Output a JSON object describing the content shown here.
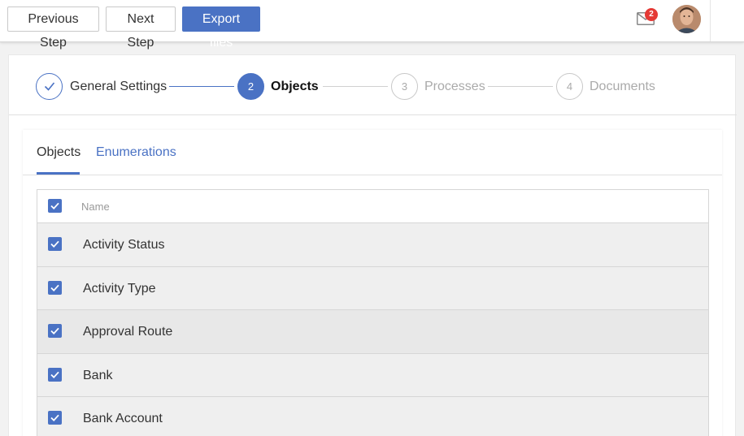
{
  "toolbar": {
    "previous_label": "Previous Step",
    "next_label": "Next Step",
    "export_label": "Export files"
  },
  "notifications": {
    "count": "2",
    "icon": "mail-icon"
  },
  "user": {
    "avatar_icon": "avatar"
  },
  "colors": {
    "accent": "#4a72c4",
    "badge": "#e53935"
  },
  "stepper": {
    "steps": [
      {
        "number": "",
        "label": "General Settings",
        "state": "done"
      },
      {
        "number": "2",
        "label": "Objects",
        "state": "active"
      },
      {
        "number": "3",
        "label": "Processes",
        "state": "todo"
      },
      {
        "number": "4",
        "label": "Documents",
        "state": "todo"
      }
    ]
  },
  "tabs": [
    {
      "label": "Objects",
      "active": true
    },
    {
      "label": "Enumerations",
      "active": false
    }
  ],
  "table": {
    "header": {
      "name": "Name",
      "checked": true
    },
    "rows": [
      {
        "name": "Activity Status",
        "checked": true
      },
      {
        "name": "Activity Type",
        "checked": true
      },
      {
        "name": "Approval Route",
        "checked": true
      },
      {
        "name": "Bank",
        "checked": true
      },
      {
        "name": "Bank Account",
        "checked": true
      }
    ]
  }
}
